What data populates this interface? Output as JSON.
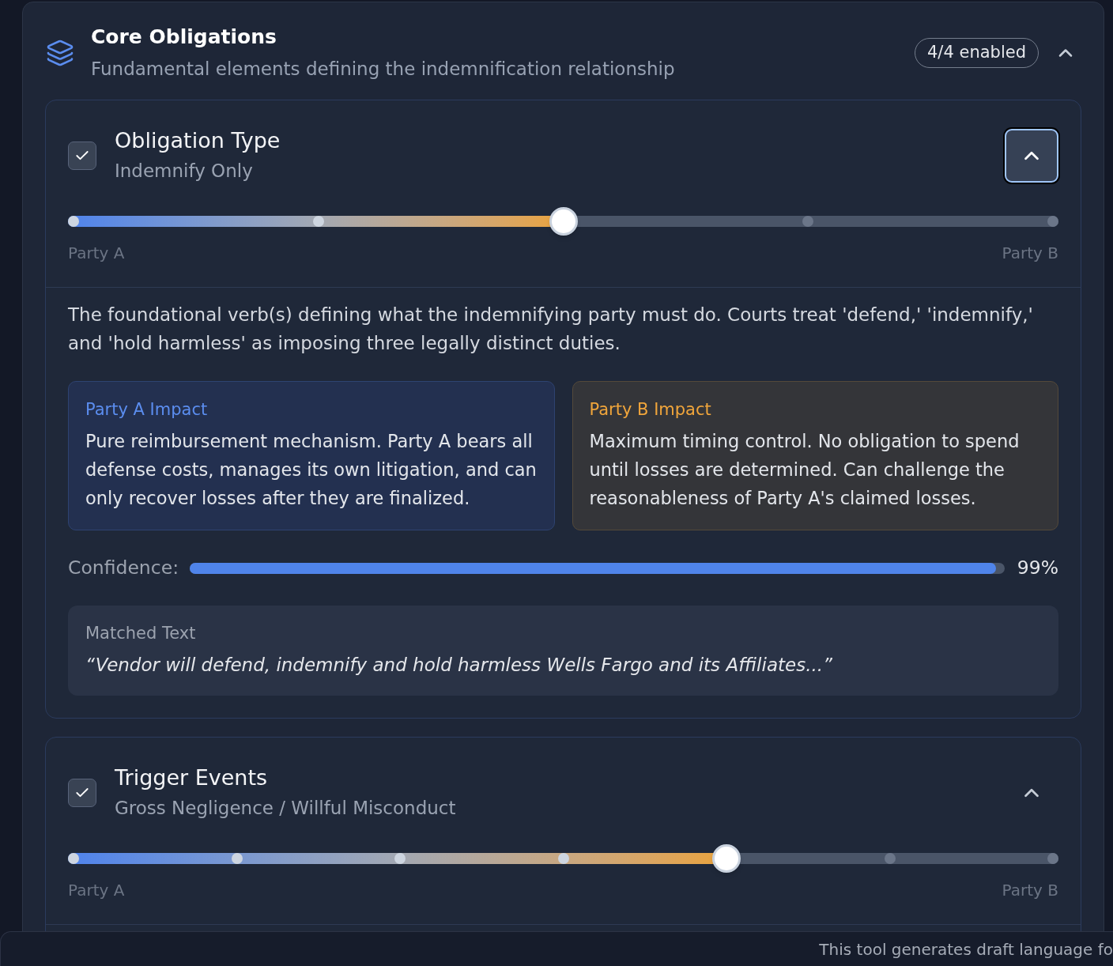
{
  "section": {
    "title": "Core Obligations",
    "subtitle": "Fundamental elements defining the indemnification relationship",
    "badge": "4/4 enabled",
    "expanded": true
  },
  "parameters": [
    {
      "title": "Obligation Type",
      "value": "Indemnify Only",
      "checked": true,
      "expanded": true,
      "focused": true,
      "slider": {
        "level": 0.5,
        "stops": [
          {
            "selected": false
          },
          {
            "selected": false
          },
          {
            "selected": true
          },
          {
            "selected": false
          },
          {
            "selected": false
          }
        ],
        "start_label": "Party A",
        "end_label": "Party B"
      },
      "details": {
        "description": "The foundational verb(s) defining what the indemnifying party must do. Courts treat 'defend,' 'indemnify,' and 'hold harmless' as imposing three legally distinct duties.",
        "impacts": [
          {
            "kind": "party_a",
            "title": "Party A Impact",
            "text": "Pure reimbursement mechanism. Party A bears all defense costs, manages its own litigation, and can only recover losses after they are finalized."
          },
          {
            "kind": "party_b",
            "title": "Party B Impact",
            "text": "Maximum timing control. No obligation to spend until losses are determined. Can challenge the reasonableness of Party A's claimed losses."
          }
        ],
        "confidence": {
          "label": "Confidence:",
          "level": 0.99,
          "reading": "99%"
        },
        "matched_text": {
          "label": "Matched Text",
          "quote": "“Vendor will defend, indemnify and hold harmless Wells Fargo and its Affiliates...”"
        }
      }
    },
    {
      "title": "Trigger Events",
      "value": "Gross Negligence / Willful Misconduct",
      "checked": true,
      "expanded": true,
      "focused": false,
      "slider": {
        "level": 0.667,
        "stops": [
          {
            "selected": false
          },
          {
            "selected": false
          },
          {
            "selected": false
          },
          {
            "selected": false
          },
          {
            "selected": true
          },
          {
            "selected": false
          },
          {
            "selected": false
          }
        ],
        "start_label": "Party A",
        "end_label": "Party B"
      }
    }
  ],
  "footer": {
    "text": "This tool generates draft language fo"
  }
}
